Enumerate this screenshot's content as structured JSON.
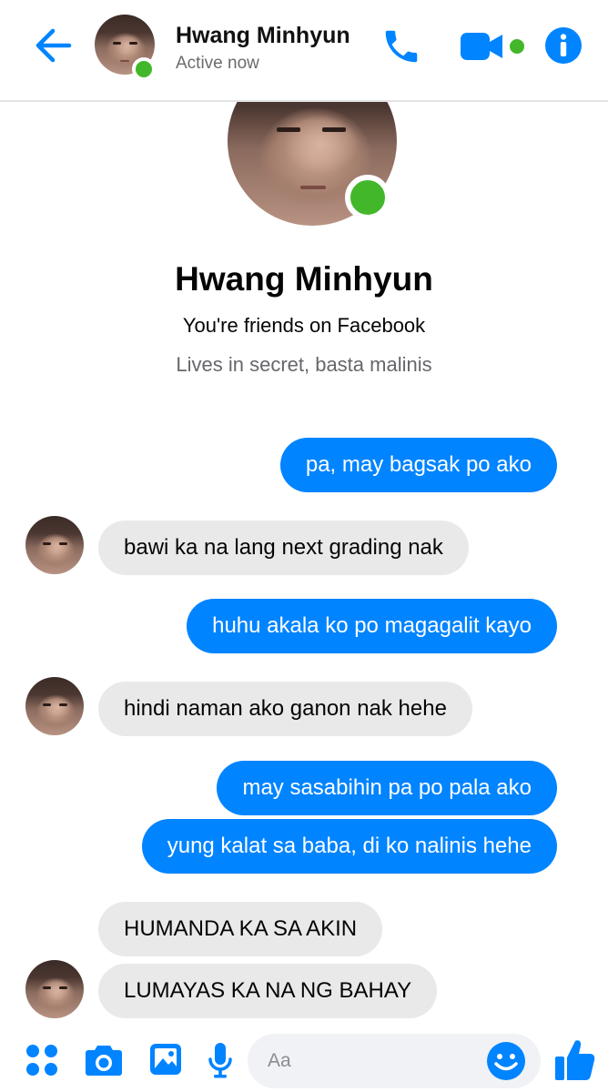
{
  "header": {
    "contact_name": "Hwang Minhyun",
    "status": "Active now",
    "icons": [
      "back-arrow-icon",
      "phone-icon",
      "video-camera-icon",
      "info-icon"
    ]
  },
  "profile": {
    "name": "Hwang Minhyun",
    "friends_text": "You're friends on Facebook",
    "bio": "Lives in secret, basta malinis"
  },
  "messages": [
    {
      "from": "me",
      "text": "pa, may bagsak po ako"
    },
    {
      "from": "contact",
      "text": "bawi ka na lang next grading nak"
    },
    {
      "from": "me",
      "text": "huhu akala ko po magagalit kayo"
    },
    {
      "from": "contact",
      "text": "hindi naman ako ganon nak hehe"
    },
    {
      "from": "me",
      "text": "may sasabihin pa po pala ako"
    },
    {
      "from": "me",
      "text": "yung kalat sa baba, di ko nalinis hehe"
    },
    {
      "from": "contact",
      "text": "HUMANDA KA SA AKIN"
    },
    {
      "from": "contact",
      "text": "LUMAYAS KA NA NG BAHAY"
    }
  ],
  "composer": {
    "placeholder": "Aa",
    "icons": [
      "apps-grid-icon",
      "camera-icon",
      "gallery-icon",
      "microphone-icon",
      "emoji-icon",
      "thumbs-up-icon"
    ]
  },
  "colors": {
    "accent": "#0084ff",
    "online": "#42b72a",
    "received_bubble": "#e9e9ea",
    "sent_bubble": "#0084ff"
  }
}
